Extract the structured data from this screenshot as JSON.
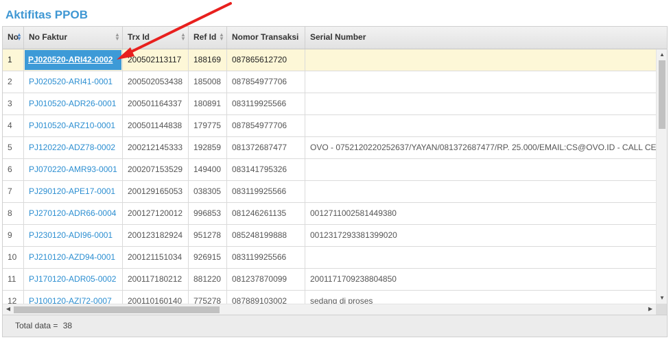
{
  "page": {
    "title": "Aktifitas PPOB"
  },
  "table": {
    "columns": [
      "No",
      "No Faktur",
      "Trx Id",
      "Ref Id",
      "Nomor Transaksi",
      "Serial Number"
    ],
    "rows": [
      {
        "no": "1",
        "faktur": "PJ020520-ARI42-0002",
        "trx": "200502113117",
        "ref": "188169",
        "nomor": "087865612720",
        "serial": ""
      },
      {
        "no": "2",
        "faktur": "PJ020520-ARI41-0001",
        "trx": "200502053438",
        "ref": "185008",
        "nomor": "087854977706",
        "serial": ""
      },
      {
        "no": "3",
        "faktur": "PJ010520-ADR26-0001",
        "trx": "200501164337",
        "ref": "180891",
        "nomor": "083119925566",
        "serial": ""
      },
      {
        "no": "4",
        "faktur": "PJ010520-ARZ10-0001",
        "trx": "200501144838",
        "ref": "179775",
        "nomor": "087854977706",
        "serial": ""
      },
      {
        "no": "5",
        "faktur": "PJ120220-ADZ78-0002",
        "trx": "200212145333",
        "ref": "192859",
        "nomor": "081372687477",
        "serial": "OVO - 0752120220252637/YAYAN/081372687477/RP. 25.000/EMAIL:CS@OVO.ID - CALL CE"
      },
      {
        "no": "6",
        "faktur": "PJ070220-AMR93-0001",
        "trx": "200207153529",
        "ref": "149400",
        "nomor": "083141795326",
        "serial": ""
      },
      {
        "no": "7",
        "faktur": "PJ290120-APE17-0001",
        "trx": "200129165053",
        "ref": "038305",
        "nomor": "083119925566",
        "serial": ""
      },
      {
        "no": "8",
        "faktur": "PJ270120-ADR66-0004",
        "trx": "200127120012",
        "ref": "996853",
        "nomor": "081246261135",
        "serial": "0012711002581449380"
      },
      {
        "no": "9",
        "faktur": "PJ230120-ADI96-0001",
        "trx": "200123182924",
        "ref": "951278",
        "nomor": "085248199888",
        "serial": "0012317293381399020"
      },
      {
        "no": "10",
        "faktur": "PJ210120-AZD94-0001",
        "trx": "200121151034",
        "ref": "926915",
        "nomor": "083119925566",
        "serial": ""
      },
      {
        "no": "11",
        "faktur": "PJ170120-ADR05-0002",
        "trx": "200117180212",
        "ref": "881220",
        "nomor": "081237870099",
        "serial": "2001171709238804850"
      },
      {
        "no": "12",
        "faktur": "PJ100120-AZI72-0007",
        "trx": "200110160140",
        "ref": "775278",
        "nomor": "087889103002",
        "serial": "sedang di proses"
      }
    ]
  },
  "footer": {
    "total_label": "Total data =",
    "total_value": "38"
  },
  "colors": {
    "accent": "#3f97d3",
    "selected_row": "#fdf7d7",
    "highlight": "#3d9ad7",
    "arrow": "#e8201e"
  },
  "icons": {
    "sort": "sort-arrows-icon",
    "annotation": "red-arrow"
  }
}
